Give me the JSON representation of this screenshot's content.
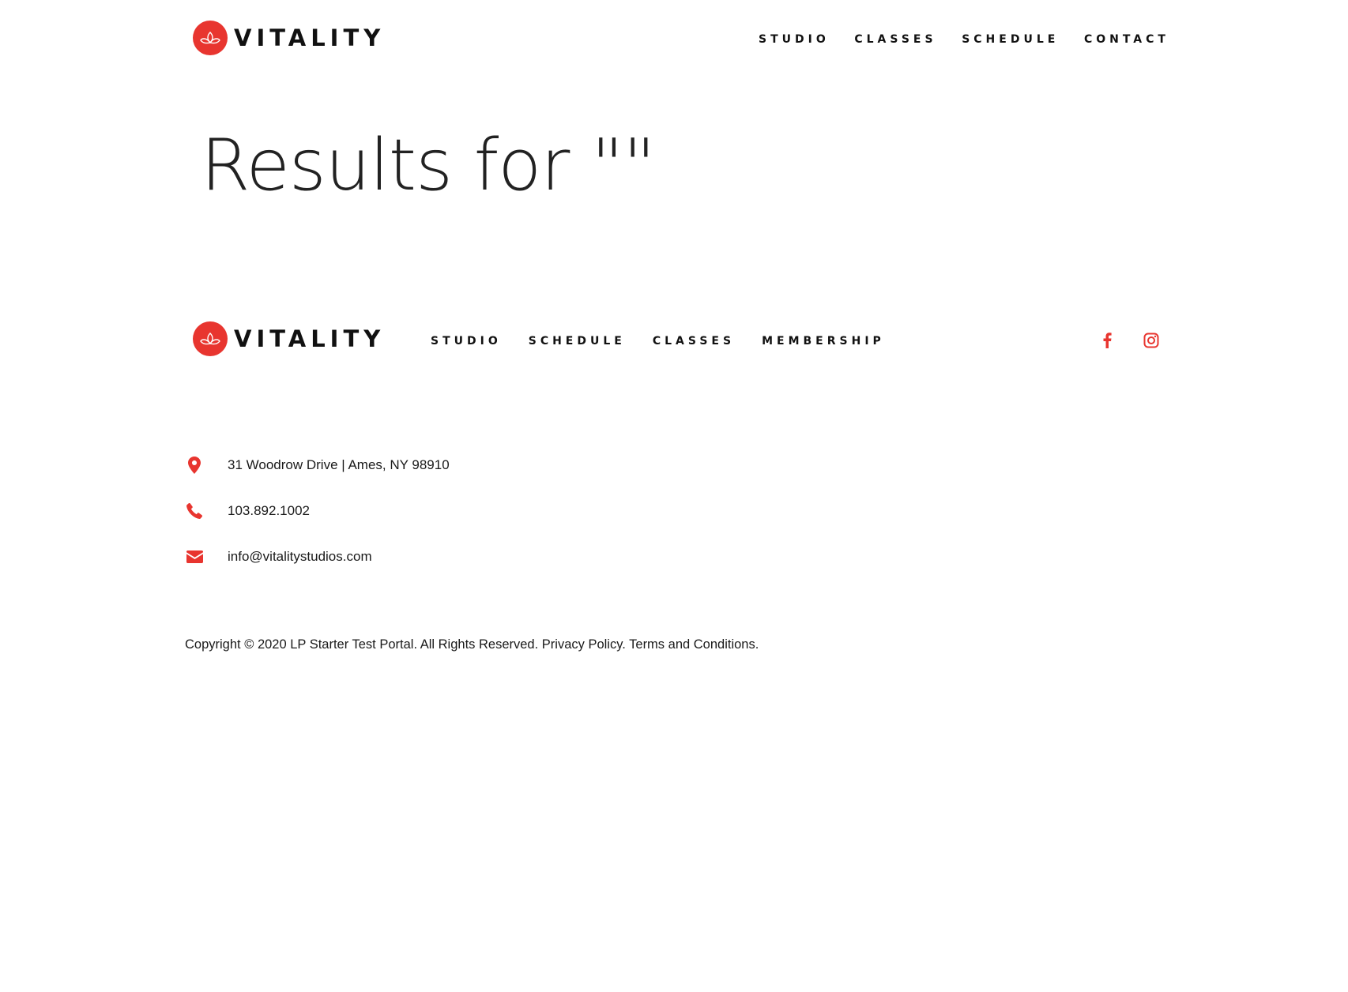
{
  "brand": {
    "name": "VITALITY",
    "accent_color": "#e8352f",
    "logo_icon": "lotus-logo-icon"
  },
  "header": {
    "nav": [
      "STUDIO",
      "CLASSES",
      "SCHEDULE",
      "CONTACT"
    ]
  },
  "main": {
    "title": "Results for \"\""
  },
  "footer": {
    "nav": [
      "STUDIO",
      "SCHEDULE",
      "CLASSES",
      "MEMBERSHIP"
    ],
    "social": [
      {
        "icon": "facebook-icon"
      },
      {
        "icon": "instagram-icon"
      }
    ],
    "contact": {
      "address": "31 Woodrow Drive | Ames, NY 98910",
      "address_icon": "map-pin-icon",
      "phone": "103.892.1002",
      "phone_icon": "phone-icon",
      "email": "info@vitalitystudios.com",
      "email_icon": "envelope-icon"
    },
    "copyright": {
      "text": "Copyright © 2020 LP Starter Test Portal. All Rights Reserved.",
      "privacy": "Privacy Policy.",
      "terms": "Terms and Conditions."
    }
  }
}
